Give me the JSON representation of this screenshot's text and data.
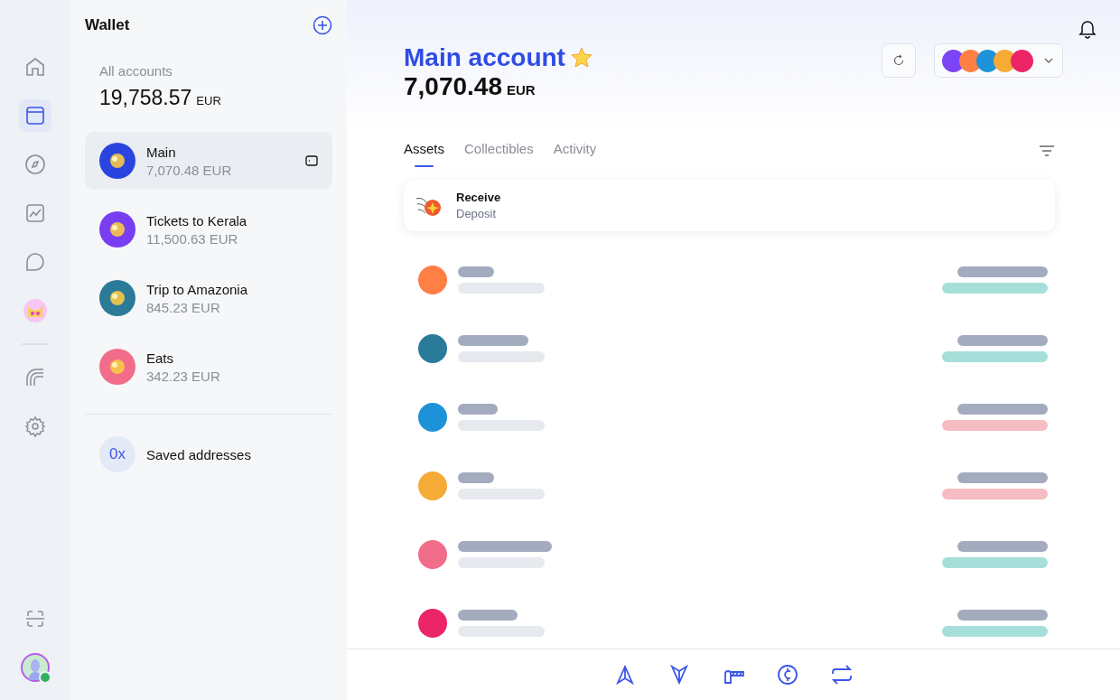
{
  "nav": {
    "items": [
      {
        "kind": "home",
        "selected": false
      },
      {
        "kind": "wallet",
        "selected": true
      },
      {
        "kind": "compass",
        "selected": false
      },
      {
        "kind": "chart",
        "selected": false
      },
      {
        "kind": "chat",
        "selected": false
      },
      {
        "kind": "cat",
        "selected": false
      }
    ],
    "more": [
      {
        "kind": "rainbow",
        "selected": false
      },
      {
        "kind": "gear",
        "selected": false
      }
    ],
    "bottom": [
      {
        "kind": "scan",
        "selected": false
      },
      {
        "kind": "avatar",
        "selected": false
      }
    ],
    "online": true
  },
  "sidebar": {
    "title": "Wallet",
    "total_label": "All accounts",
    "total_value": "19,758.57",
    "total_currency": "EUR",
    "accounts": [
      {
        "name": "Main",
        "balance": "7,070.48 EUR",
        "color": "#2a44e0",
        "selected": true
      },
      {
        "name": "Tickets to Kerala",
        "balance": "11,500.63 EUR",
        "color": "#7a3ef2",
        "selected": false
      },
      {
        "name": "Trip to Amazonia",
        "balance": "845.23 EUR",
        "color": "#2a7a98",
        "selected": false
      },
      {
        "name": "Eats",
        "balance": "342.23 EUR",
        "color": "#f26d8a",
        "selected": false
      }
    ],
    "saved": {
      "icon_text": "0x",
      "label": "Saved addresses"
    }
  },
  "main": {
    "title": "Main account",
    "balance": "7,070.48",
    "currency": "EUR",
    "networks": [
      {
        "color": "#7b45f5"
      },
      {
        "color": "#ff7f45"
      },
      {
        "color": "#1e92d8"
      },
      {
        "color": "#f5ab35"
      },
      {
        "color": "#ec2566"
      }
    ],
    "tabs": [
      {
        "label": "Assets",
        "selected": true
      },
      {
        "label": "Collectibles",
        "selected": false
      },
      {
        "label": "Activity",
        "selected": false
      }
    ],
    "banner": {
      "title": "Receive",
      "subtitle": "Deposit"
    },
    "assets": [
      {
        "color": "#ff7f45",
        "change_bar": {
          "color": "#a6dfd9"
        }
      },
      {
        "color": "#2a7a9a",
        "change_bar": {
          "color": "#a6dfd9"
        }
      },
      {
        "color": "#1e92d8",
        "change_bar": {
          "color": "#f5bcc2"
        }
      },
      {
        "color": "#f5ab35",
        "change_bar": {
          "color": "#f5bcc2"
        }
      },
      {
        "color": "#f26d8a",
        "change_bar": {
          "color": "#a6dfd9"
        }
      },
      {
        "color": "#ec2566",
        "change_bar": {
          "color": "#a6dfd9"
        }
      }
    ],
    "actions": [
      {
        "kind": "send"
      },
      {
        "kind": "receive"
      },
      {
        "kind": "bridge"
      },
      {
        "kind": "coin"
      },
      {
        "kind": "swap"
      }
    ]
  }
}
